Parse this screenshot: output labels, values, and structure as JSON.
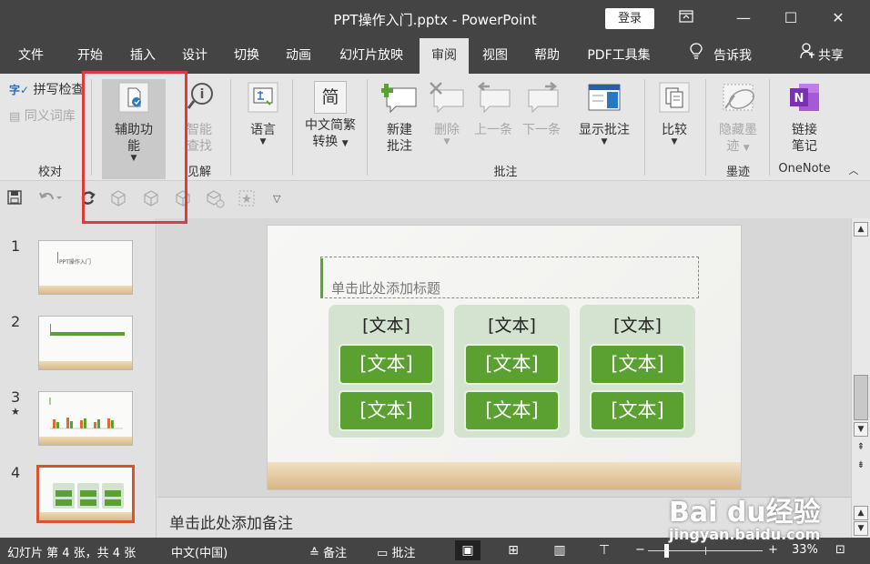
{
  "window": {
    "title": "PPT操作入门.pptx - PowerPoint",
    "login_label": "登录",
    "ribbon_display_icon": "ribbon-display-icon",
    "minimize_glyph": "—",
    "maximize_glyph": "☐",
    "close_glyph": "✕"
  },
  "tabs": [
    "文件",
    "开始",
    "插入",
    "设计",
    "切换",
    "动画",
    "幻灯片放映",
    "审阅",
    "视图",
    "帮助",
    "PDF工具集"
  ],
  "active_tab": "审阅",
  "tell_me": "告诉我",
  "share": "共享",
  "ribbon": {
    "spell_check": "拼写检查",
    "thesaurus": "同义词库",
    "group_proofing": "校对",
    "accessibility_l1": "辅助功",
    "accessibility_l2": "能",
    "smart_lookup_l1": "智能",
    "smart_lookup_l2": "查找",
    "group_insights": "见解",
    "language": "语言",
    "chinese_conversion_l1": "中文简繁",
    "chinese_conversion_l2": "转换",
    "conversion_icon_char": "简",
    "new_comment_l1": "新建",
    "new_comment_l2": "批注",
    "delete": "删除",
    "previous": "上一条",
    "next": "下一条",
    "show_comments": "显示批注",
    "group_comments": "批注",
    "compare": "比较",
    "hide_ink_l1": "隐藏墨",
    "hide_ink_l2": "迹",
    "group_ink": "墨迹",
    "linked_notes_l1": "链接",
    "linked_notes_l2": "笔记",
    "group_onenote": "OneNote"
  },
  "slides_panel": {
    "numbers": [
      "1",
      "2",
      "3",
      "4"
    ],
    "slide3_star": "★",
    "slide1_title": "PPT操作入门"
  },
  "slide": {
    "title_placeholder": "单击此处添加标题",
    "columns": [
      {
        "header": "[文本]",
        "box1": "[文本]",
        "box2": "[文本]"
      },
      {
        "header": "[文本]",
        "box1": "[文本]",
        "box2": "[文本]"
      },
      {
        "header": "[文本]",
        "box1": "[文本]",
        "box2": "[文本]"
      }
    ]
  },
  "notes_placeholder": "单击此处添加备注",
  "status": {
    "slide_info": "幻灯片 第 4 张，共 4 张",
    "language": "中文(中国)",
    "notes_btn": "备注",
    "comments_btn": "批注",
    "zoom_minus": "−",
    "zoom_plus": "+",
    "zoom": "33%",
    "zoom_level_fraction": 0.33
  },
  "watermark": {
    "brand": "Bai du经验",
    "url": "jingyan.baidu.com"
  },
  "colors": {
    "accent_green": "#5aa132",
    "highlight_red": "#e0393e",
    "onenote_purple": "#7b2fb2"
  }
}
